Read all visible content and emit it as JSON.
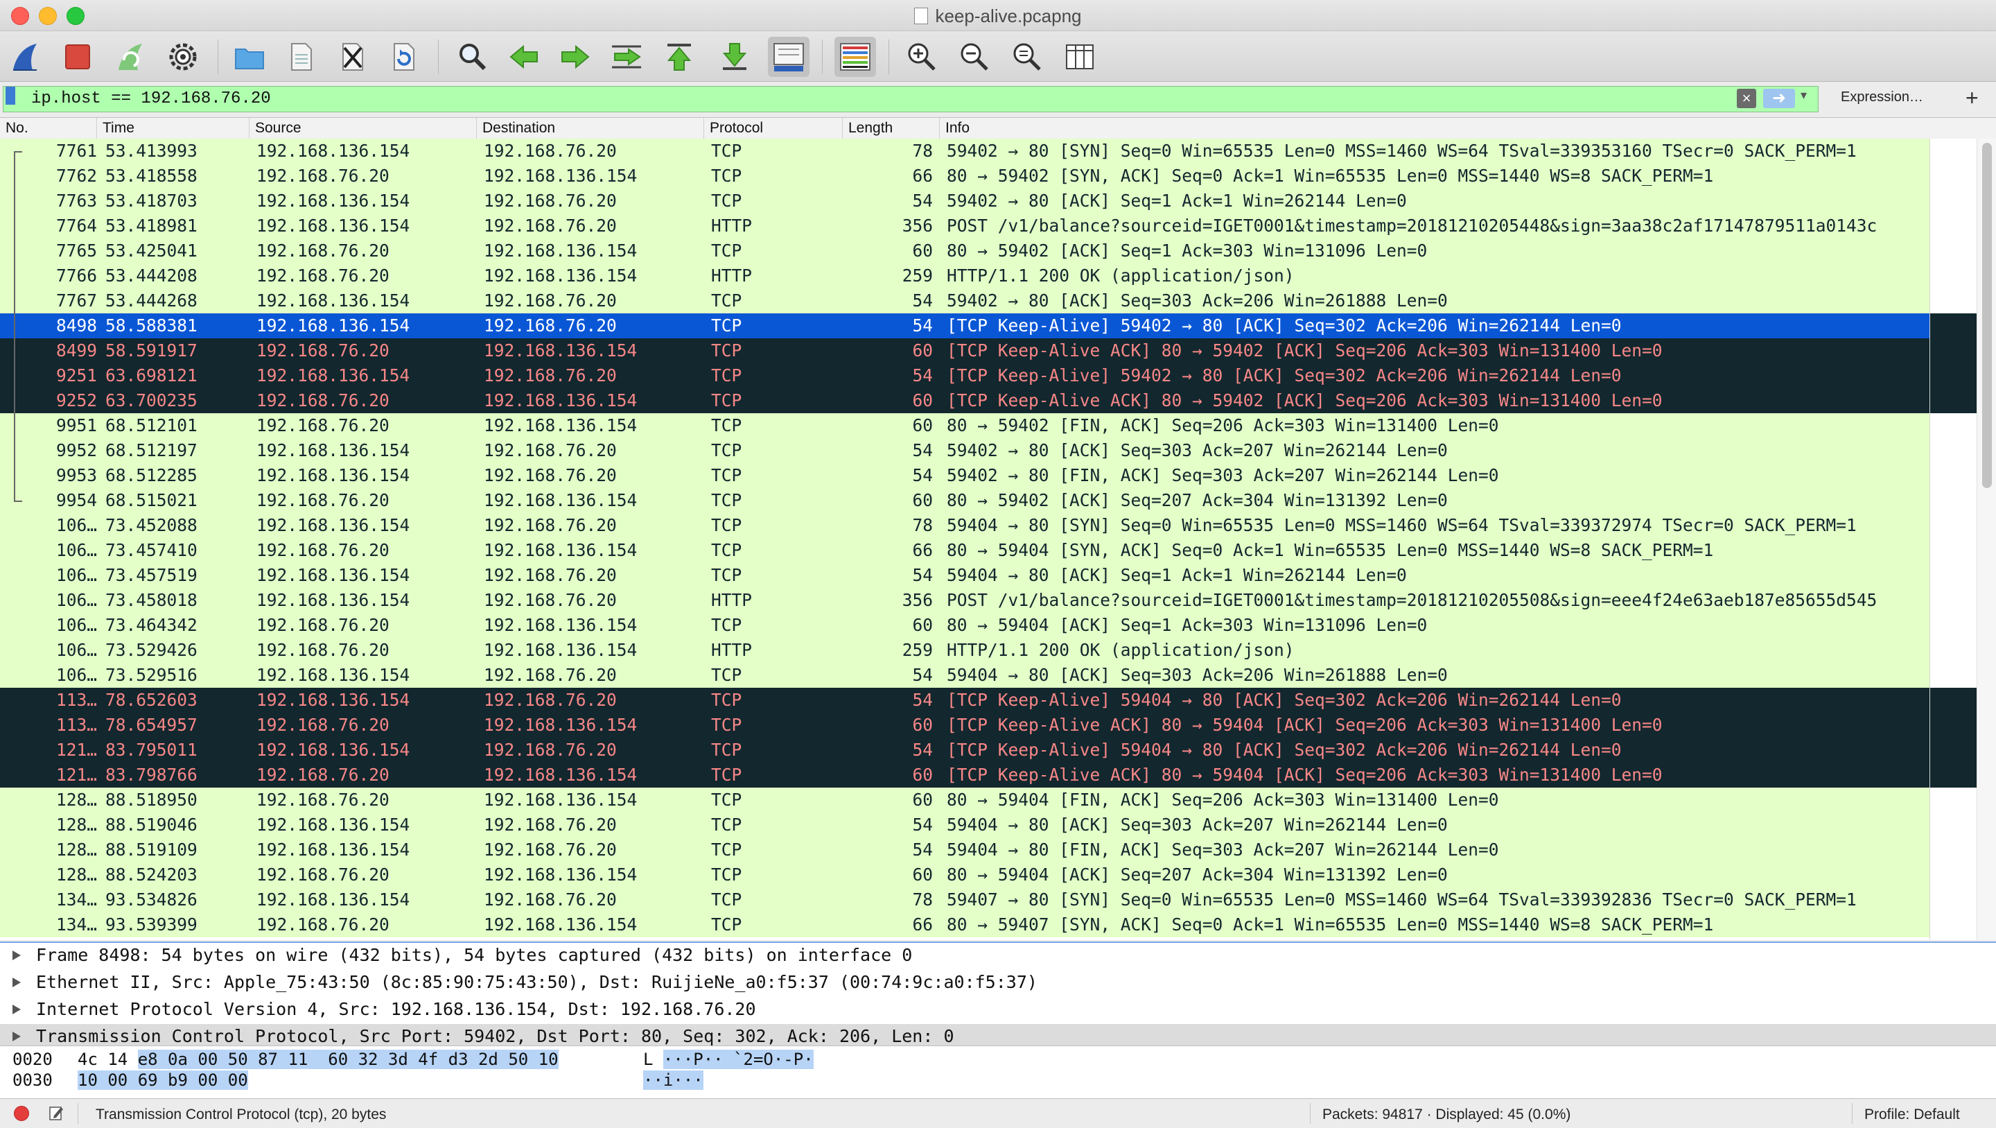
{
  "window": {
    "title": "keep-alive.pcapng"
  },
  "toolbar": {
    "buttons": [
      {
        "name": "start-capture-icon",
        "hint": "shark fin"
      },
      {
        "name": "stop-capture-icon",
        "hint": "stop"
      },
      {
        "name": "restart-capture-icon",
        "hint": "restart"
      },
      {
        "name": "capture-options-icon",
        "hint": "gear"
      },
      {
        "name": "open-file-icon",
        "hint": "folder"
      },
      {
        "name": "save-file-icon",
        "hint": "document"
      },
      {
        "name": "close-file-icon",
        "hint": "close"
      },
      {
        "name": "reload-file-icon",
        "hint": "reload"
      },
      {
        "name": "find-packet-icon",
        "hint": "magnifier"
      },
      {
        "name": "go-back-icon",
        "hint": "back"
      },
      {
        "name": "go-forward-icon",
        "hint": "forward"
      },
      {
        "name": "go-to-packet-icon",
        "hint": "jump"
      },
      {
        "name": "go-first-packet-icon",
        "hint": "first"
      },
      {
        "name": "go-last-packet-icon",
        "hint": "last"
      },
      {
        "name": "auto-scroll-icon",
        "hint": "autoscroll"
      },
      {
        "name": "colorize-icon",
        "hint": "colorize"
      },
      {
        "name": "zoom-in-icon",
        "hint": "zoom in"
      },
      {
        "name": "zoom-out-icon",
        "hint": "zoom out"
      },
      {
        "name": "normal-size-icon",
        "hint": "normal size"
      },
      {
        "name": "resize-columns-icon",
        "hint": "resize columns"
      }
    ]
  },
  "filter": {
    "value": "ip.host == 192.168.76.20",
    "expression_label": "Expression…",
    "add_label": "+"
  },
  "columns": [
    "No.",
    "Time",
    "Source",
    "Destination",
    "Protocol",
    "Length",
    "Info"
  ],
  "packets": [
    {
      "no": "7761",
      "time": "53.413993",
      "src": "192.168.136.154",
      "dst": "192.168.76.20",
      "proto": "TCP",
      "len": "78",
      "info": "59402 → 80 [SYN] Seq=0 Win=65535 Len=0 MSS=1460 WS=64 TSval=339353160 TSecr=0 SACK_PERM=1",
      "style": "normal"
    },
    {
      "no": "7762",
      "time": "53.418558",
      "src": "192.168.76.20",
      "dst": "192.168.136.154",
      "proto": "TCP",
      "len": "66",
      "info": "80 → 59402 [SYN, ACK] Seq=0 Ack=1 Win=65535 Len=0 MSS=1440 WS=8 SACK_PERM=1",
      "style": "normal"
    },
    {
      "no": "7763",
      "time": "53.418703",
      "src": "192.168.136.154",
      "dst": "192.168.76.20",
      "proto": "TCP",
      "len": "54",
      "info": "59402 → 80 [ACK] Seq=1 Ack=1 Win=262144 Len=0",
      "style": "normal"
    },
    {
      "no": "7764",
      "time": "53.418981",
      "src": "192.168.136.154",
      "dst": "192.168.76.20",
      "proto": "HTTP",
      "len": "356",
      "info": "POST /v1/balance?sourceid=IGET0001&timestamp=20181210205448&sign=3aa38c2af17147879511a0143c",
      "style": "normal"
    },
    {
      "no": "7765",
      "time": "53.425041",
      "src": "192.168.76.20",
      "dst": "192.168.136.154",
      "proto": "TCP",
      "len": "60",
      "info": "80 → 59402 [ACK] Seq=1 Ack=303 Win=131096 Len=0",
      "style": "normal"
    },
    {
      "no": "7766",
      "time": "53.444208",
      "src": "192.168.76.20",
      "dst": "192.168.136.154",
      "proto": "HTTP",
      "len": "259",
      "info": "HTTP/1.1 200 OK  (application/json)",
      "style": "normal"
    },
    {
      "no": "7767",
      "time": "53.444268",
      "src": "192.168.136.154",
      "dst": "192.168.76.20",
      "proto": "TCP",
      "len": "54",
      "info": "59402 → 80 [ACK] Seq=303 Ack=206 Win=261888 Len=0",
      "style": "normal"
    },
    {
      "no": "8498",
      "time": "58.588381",
      "src": "192.168.136.154",
      "dst": "192.168.76.20",
      "proto": "TCP",
      "len": "54",
      "info": "[TCP Keep-Alive] 59402 → 80 [ACK] Seq=302 Ack=206 Win=262144 Len=0",
      "style": "sel"
    },
    {
      "no": "8499",
      "time": "58.591917",
      "src": "192.168.76.20",
      "dst": "192.168.136.154",
      "proto": "TCP",
      "len": "60",
      "info": "[TCP Keep-Alive ACK] 80 → 59402 [ACK] Seq=206 Ack=303 Win=131400 Len=0",
      "style": "ka"
    },
    {
      "no": "9251",
      "time": "63.698121",
      "src": "192.168.136.154",
      "dst": "192.168.76.20",
      "proto": "TCP",
      "len": "54",
      "info": "[TCP Keep-Alive] 59402 → 80 [ACK] Seq=302 Ack=206 Win=262144 Len=0",
      "style": "ka"
    },
    {
      "no": "9252",
      "time": "63.700235",
      "src": "192.168.76.20",
      "dst": "192.168.136.154",
      "proto": "TCP",
      "len": "60",
      "info": "[TCP Keep-Alive ACK] 80 → 59402 [ACK] Seq=206 Ack=303 Win=131400 Len=0",
      "style": "ka"
    },
    {
      "no": "9951",
      "time": "68.512101",
      "src": "192.168.76.20",
      "dst": "192.168.136.154",
      "proto": "TCP",
      "len": "60",
      "info": "80 → 59402 [FIN, ACK] Seq=206 Ack=303 Win=131400 Len=0",
      "style": "normal"
    },
    {
      "no": "9952",
      "time": "68.512197",
      "src": "192.168.136.154",
      "dst": "192.168.76.20",
      "proto": "TCP",
      "len": "54",
      "info": "59402 → 80 [ACK] Seq=303 Ack=207 Win=262144 Len=0",
      "style": "normal"
    },
    {
      "no": "9953",
      "time": "68.512285",
      "src": "192.168.136.154",
      "dst": "192.168.76.20",
      "proto": "TCP",
      "len": "54",
      "info": "59402 → 80 [FIN, ACK] Seq=303 Ack=207 Win=262144 Len=0",
      "style": "normal"
    },
    {
      "no": "9954",
      "time": "68.515021",
      "src": "192.168.76.20",
      "dst": "192.168.136.154",
      "proto": "TCP",
      "len": "60",
      "info": "80 → 59402 [ACK] Seq=207 Ack=304 Win=131392 Len=0",
      "style": "normal"
    },
    {
      "no": "106…",
      "time": "73.452088",
      "src": "192.168.136.154",
      "dst": "192.168.76.20",
      "proto": "TCP",
      "len": "78",
      "info": "59404 → 80 [SYN] Seq=0 Win=65535 Len=0 MSS=1460 WS=64 TSval=339372974 TSecr=0 SACK_PERM=1",
      "style": "normal"
    },
    {
      "no": "106…",
      "time": "73.457410",
      "src": "192.168.76.20",
      "dst": "192.168.136.154",
      "proto": "TCP",
      "len": "66",
      "info": "80 → 59404 [SYN, ACK] Seq=0 Ack=1 Win=65535 Len=0 MSS=1440 WS=8 SACK_PERM=1",
      "style": "normal"
    },
    {
      "no": "106…",
      "time": "73.457519",
      "src": "192.168.136.154",
      "dst": "192.168.76.20",
      "proto": "TCP",
      "len": "54",
      "info": "59404 → 80 [ACK] Seq=1 Ack=1 Win=262144 Len=0",
      "style": "normal"
    },
    {
      "no": "106…",
      "time": "73.458018",
      "src": "192.168.136.154",
      "dst": "192.168.76.20",
      "proto": "HTTP",
      "len": "356",
      "info": "POST /v1/balance?sourceid=IGET0001&timestamp=20181210205508&sign=eee4f24e63aeb187e85655d545",
      "style": "normal"
    },
    {
      "no": "106…",
      "time": "73.464342",
      "src": "192.168.76.20",
      "dst": "192.168.136.154",
      "proto": "TCP",
      "len": "60",
      "info": "80 → 59404 [ACK] Seq=1 Ack=303 Win=131096 Len=0",
      "style": "normal"
    },
    {
      "no": "106…",
      "time": "73.529426",
      "src": "192.168.76.20",
      "dst": "192.168.136.154",
      "proto": "HTTP",
      "len": "259",
      "info": "HTTP/1.1 200 OK  (application/json)",
      "style": "normal"
    },
    {
      "no": "106…",
      "time": "73.529516",
      "src": "192.168.136.154",
      "dst": "192.168.76.20",
      "proto": "TCP",
      "len": "54",
      "info": "59404 → 80 [ACK] Seq=303 Ack=206 Win=261888 Len=0",
      "style": "normal"
    },
    {
      "no": "113…",
      "time": "78.652603",
      "src": "192.168.136.154",
      "dst": "192.168.76.20",
      "proto": "TCP",
      "len": "54",
      "info": "[TCP Keep-Alive] 59404 → 80 [ACK] Seq=302 Ack=206 Win=262144 Len=0",
      "style": "ka"
    },
    {
      "no": "113…",
      "time": "78.654957",
      "src": "192.168.76.20",
      "dst": "192.168.136.154",
      "proto": "TCP",
      "len": "60",
      "info": "[TCP Keep-Alive ACK] 80 → 59404 [ACK] Seq=206 Ack=303 Win=131400 Len=0",
      "style": "ka"
    },
    {
      "no": "121…",
      "time": "83.795011",
      "src": "192.168.136.154",
      "dst": "192.168.76.20",
      "proto": "TCP",
      "len": "54",
      "info": "[TCP Keep-Alive] 59404 → 80 [ACK] Seq=302 Ack=206 Win=262144 Len=0",
      "style": "ka"
    },
    {
      "no": "121…",
      "time": "83.798766",
      "src": "192.168.76.20",
      "dst": "192.168.136.154",
      "proto": "TCP",
      "len": "60",
      "info": "[TCP Keep-Alive ACK] 80 → 59404 [ACK] Seq=206 Ack=303 Win=131400 Len=0",
      "style": "ka"
    },
    {
      "no": "128…",
      "time": "88.518950",
      "src": "192.168.76.20",
      "dst": "192.168.136.154",
      "proto": "TCP",
      "len": "60",
      "info": "80 → 59404 [FIN, ACK] Seq=206 Ack=303 Win=131400 Len=0",
      "style": "normal"
    },
    {
      "no": "128…",
      "time": "88.519046",
      "src": "192.168.136.154",
      "dst": "192.168.76.20",
      "proto": "TCP",
      "len": "54",
      "info": "59404 → 80 [ACK] Seq=303 Ack=207 Win=262144 Len=0",
      "style": "normal"
    },
    {
      "no": "128…",
      "time": "88.519109",
      "src": "192.168.136.154",
      "dst": "192.168.76.20",
      "proto": "TCP",
      "len": "54",
      "info": "59404 → 80 [FIN, ACK] Seq=303 Ack=207 Win=262144 Len=0",
      "style": "normal"
    },
    {
      "no": "128…",
      "time": "88.524203",
      "src": "192.168.76.20",
      "dst": "192.168.136.154",
      "proto": "TCP",
      "len": "60",
      "info": "80 → 59404 [ACK] Seq=207 Ack=304 Win=131392 Len=0",
      "style": "normal"
    },
    {
      "no": "134…",
      "time": "93.534826",
      "src": "192.168.136.154",
      "dst": "192.168.76.20",
      "proto": "TCP",
      "len": "78",
      "info": "59407 → 80 [SYN] Seq=0 Win=65535 Len=0 MSS=1460 WS=64 TSval=339392836 TSecr=0 SACK_PERM=1",
      "style": "normal"
    },
    {
      "no": "134…",
      "time": "93.539399",
      "src": "192.168.76.20",
      "dst": "192.168.136.154",
      "proto": "TCP",
      "len": "66",
      "info": "80 → 59407 [SYN, ACK] Seq=0 Ack=1 Win=65535 Len=0 MSS=1440 WS=8 SACK_PERM=1",
      "style": "normal"
    }
  ],
  "details": [
    {
      "text": "Frame 8498: 54 bytes on wire (432 bits), 54 bytes captured (432 bits) on interface 0",
      "selected": false
    },
    {
      "text": "Ethernet II, Src: Apple_75:43:50 (8c:85:90:75:43:50), Dst: RuijieNe_a0:f5:37 (00:74:9c:a0:f5:37)",
      "selected": false
    },
    {
      "text": "Internet Protocol Version 4, Src: 192.168.136.154, Dst: 192.168.76.20",
      "selected": false
    },
    {
      "text": "Transmission Control Protocol, Src Port: 59402, Dst Port: 80, Seq: 302, Ack: 206, Len: 0",
      "selected": true
    }
  ],
  "bytes": [
    {
      "offset": "0020",
      "hex_plain": "4c 14 ",
      "hex_hl": "e8 0a 00 50 87 11  60 32 3d 4f d3 2d 50 10",
      "ascii_plain": "L ",
      "ascii_hl": "···P·· `2=O·-P·"
    },
    {
      "offset": "0030",
      "hex_plain": "",
      "hex_hl": "10 00 69 b9 00 00",
      "ascii_plain": "",
      "ascii_hl": "··i···"
    }
  ],
  "status": {
    "field_info": "Transmission Control Protocol (tcp), 20 bytes",
    "packets": "Packets: 94817 · Displayed: 45 (0.0%)",
    "profile": "Profile: Default"
  },
  "colors": {
    "normal_bg": "#e4ffc7",
    "keepalive_bg": "#12272e",
    "keepalive_fg": "#f78787",
    "selected_bg": "#0a57d6",
    "filter_valid_bg": "#afffaf"
  }
}
